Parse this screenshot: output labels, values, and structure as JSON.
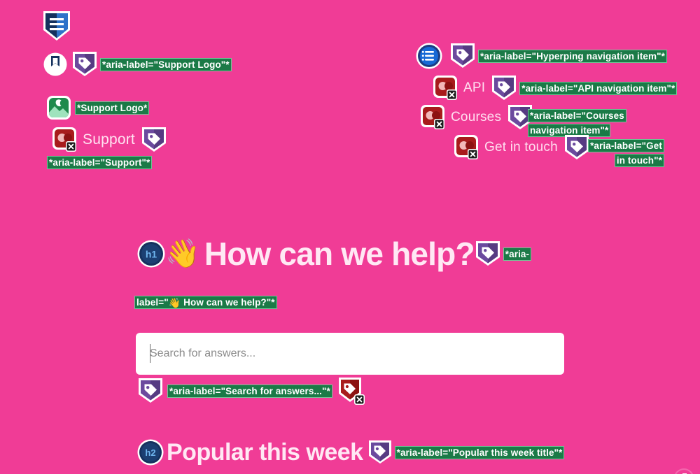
{
  "page": {
    "background_color": "#f03c96",
    "title_text_color": "#ffe8f4"
  },
  "landmark_marker": {
    "icon": "landmark-shield-icon",
    "color": "#1c3f73"
  },
  "header": {
    "logo_row": {
      "bookmark_icon": "bookmark-circle-icon",
      "tag_icon": "aria-label-tag-icon",
      "aria_label": "*aria-label=\"Support Logo\"*",
      "image_icon": "image-marker-icon",
      "image_alt": "*Support Logo*",
      "broken_link_icon": "broken-link-icon",
      "link_text": "Support",
      "link_tag_icon": "aria-label-tag-icon",
      "link_aria_label": "*aria-label=\"Support\"*"
    },
    "nav": {
      "list_icon": "nav-list-icon",
      "items": [
        {
          "tag_icon": "aria-label-tag-icon",
          "aria_label": "*aria-label=\"Hyperping navigation item\"*",
          "label": "",
          "has_link_marker": false
        },
        {
          "link_icon": "broken-link-icon",
          "label": "API",
          "tag_icon": "aria-label-tag-icon",
          "aria_label": "*aria-label=\"API navigation item\"*",
          "has_link_marker": true
        },
        {
          "link_icon": "broken-link-icon",
          "label": "Courses",
          "tag_icon": "aria-label-tag-icon",
          "aria_label": "*aria-label=\"Courses navigation item\"*",
          "has_link_marker": true
        },
        {
          "link_icon": "broken-link-icon",
          "label": "Get in touch",
          "tag_icon": "aria-label-tag-icon",
          "aria_label": "*aria-label=\"Get in touch\"*",
          "has_link_marker": true
        }
      ]
    }
  },
  "hero": {
    "heading_badge": "h1",
    "emoji": "👋",
    "heading": "How can we help?",
    "tag_icon": "aria-label-tag-icon",
    "aria_label_part1": "*aria-",
    "aria_label_part2_prefix": "label=\"",
    "aria_label_part2_emoji": "👋",
    "aria_label_part2_suffix": " How can we help?\"*"
  },
  "search": {
    "placeholder": "Search for answers...",
    "value": "",
    "tag_icon": "aria-label-tag-icon",
    "aria_label": "*aria-label=\"Search for answers...\"*",
    "missing_tag_icon": "missing-label-tag-icon"
  },
  "popular": {
    "heading_badge": "h2",
    "heading": "Popular this week",
    "tag_icon": "aria-label-tag-icon",
    "aria_label": "*aria-label=\"Popular this week title\"*"
  },
  "colors": {
    "annotation_green_bg": "#1b7a47",
    "annotation_green_border": "#6fc795",
    "tag_purple": "#6b4a9e",
    "link_red": "#a81c1c",
    "image_green": "#1f8a4c",
    "badge_navy": "#15315e",
    "nav_icon_blue": "#1769d6"
  }
}
